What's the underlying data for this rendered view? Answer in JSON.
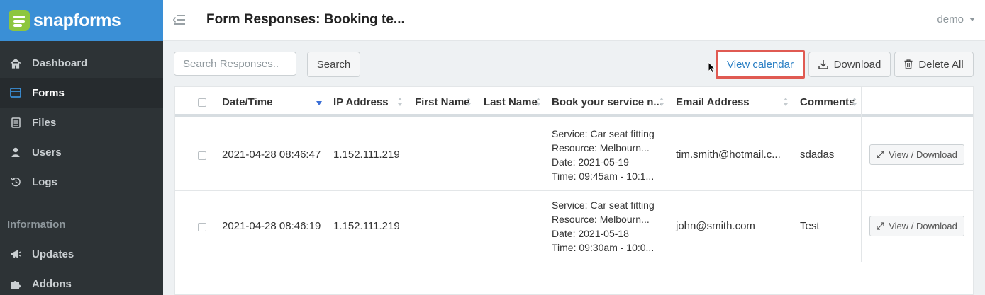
{
  "brand": {
    "name": "snapforms"
  },
  "sidebar": {
    "items": [
      {
        "label": "Dashboard",
        "icon": "home-icon"
      },
      {
        "label": "Forms",
        "icon": "forms-icon",
        "active": true
      },
      {
        "label": "Files",
        "icon": "file-icon"
      },
      {
        "label": "Users",
        "icon": "user-icon"
      },
      {
        "label": "Logs",
        "icon": "history-icon"
      }
    ],
    "section_heading": "Information",
    "info_items": [
      {
        "label": "Updates",
        "icon": "megaphone-icon"
      },
      {
        "label": "Addons",
        "icon": "puzzle-icon"
      }
    ]
  },
  "header": {
    "title": "Form Responses: Booking te...",
    "user": "demo"
  },
  "toolbar": {
    "search_placeholder": "Search Responses..",
    "search_label": "Search",
    "view_calendar_label": "View calendar",
    "download_label": "Download",
    "delete_all_label": "Delete All"
  },
  "table": {
    "columns": [
      "Date/Time",
      "IP Address",
      "First Name",
      "Last Name",
      "Book your service n...",
      "Email Address",
      "Comments"
    ],
    "rows": [
      {
        "datetime": "2021-04-28 08:46:47",
        "ip": "1.152.111.219",
        "first_name": "",
        "last_name": "",
        "booking": [
          "Service: Car seat fitting",
          "Resource: Melbourn...",
          "Date: 2021-05-19",
          "Time: 09:45am - 10:1..."
        ],
        "email": "tim.smith@hotmail.c...",
        "comments": "sdadas",
        "action_label": "View / Download"
      },
      {
        "datetime": "2021-04-28 08:46:19",
        "ip": "1.152.111.219",
        "first_name": "",
        "last_name": "",
        "booking": [
          "Service: Car seat fitting",
          "Resource: Melbourn...",
          "Date: 2021-05-18",
          "Time: 09:30am - 10:0..."
        ],
        "email": "john@smith.com",
        "comments": "Test",
        "action_label": "View / Download"
      }
    ]
  },
  "colors": {
    "brand_blue": "#3a8fd6",
    "brand_green": "#8dc63f",
    "sidebar_bg": "#2d3336",
    "highlight_red": "#e05a52",
    "link_blue": "#2a7fc4"
  }
}
